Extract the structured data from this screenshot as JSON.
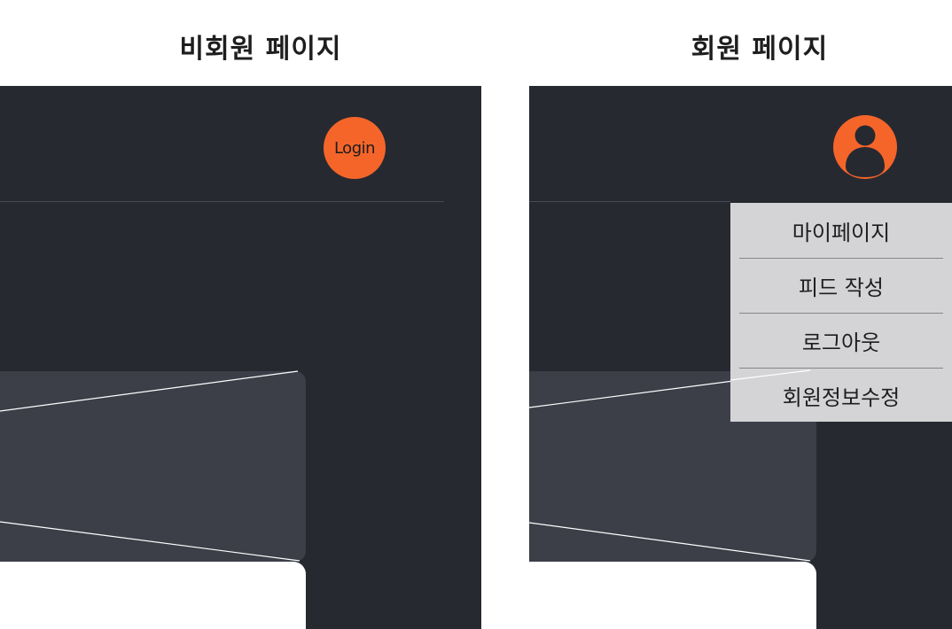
{
  "guest_page": {
    "title": "비회원 페이지",
    "login_label": "Login"
  },
  "member_page": {
    "title": "회원 페이지",
    "avatar_icon": "user-avatar-icon",
    "menu_items": [
      "마이페이지",
      "피드 작성",
      "로그아웃",
      "회원정보수정"
    ]
  },
  "colors": {
    "background": "#ffffff",
    "panel": "#272931",
    "card": "#3c3e48",
    "accent": "#f5652a",
    "menu": "#d4d4d7"
  }
}
